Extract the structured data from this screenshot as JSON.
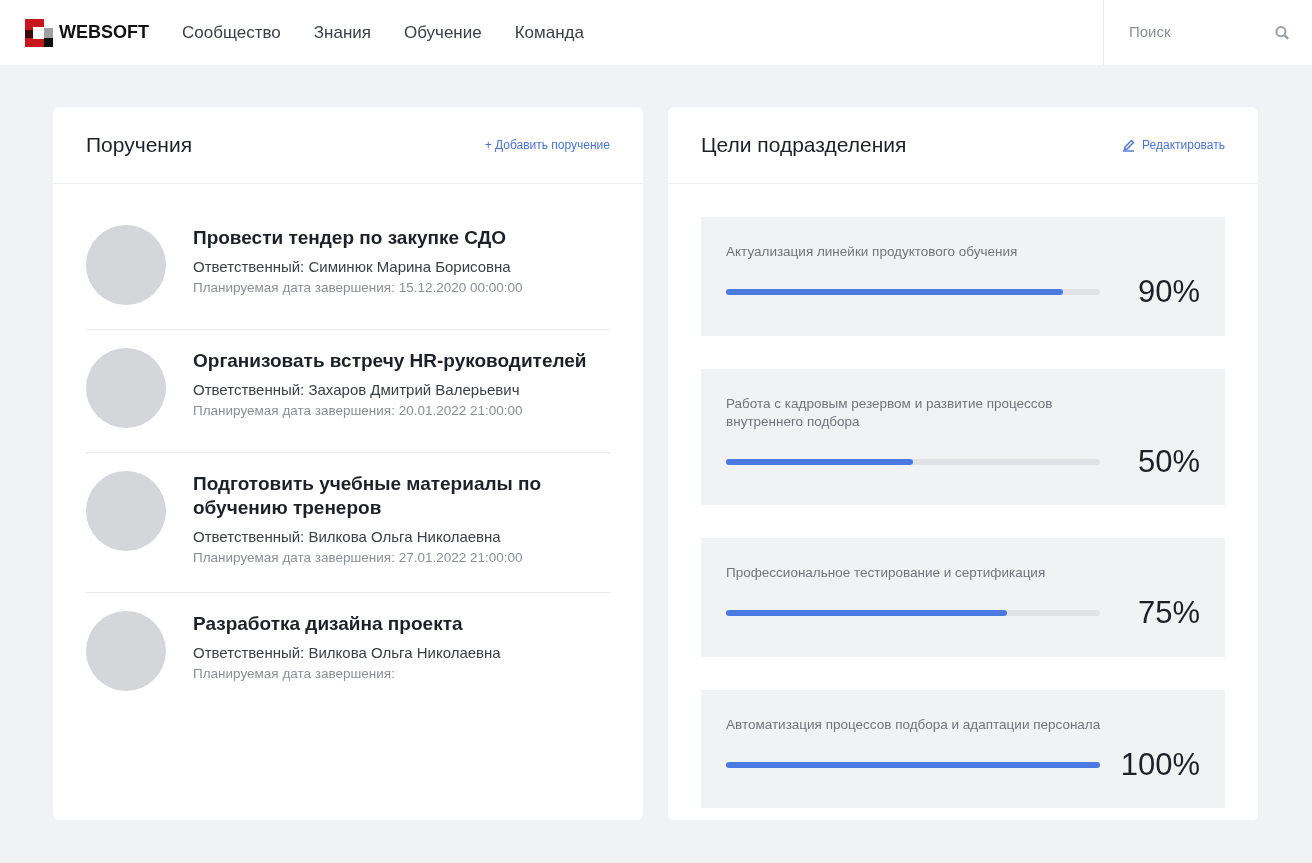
{
  "header": {
    "logo": "WEBSOFT",
    "nav": [
      {
        "label": "Сообщество"
      },
      {
        "label": "Знания"
      },
      {
        "label": "Обучение"
      },
      {
        "label": "Команда"
      }
    ],
    "search": {
      "placeholder": "Поиск"
    }
  },
  "tasks": {
    "title": "Поручения",
    "action": "+ Добавить поручение",
    "items": [
      {
        "title": "Провести тендер по закупке СДО",
        "responsible": "Ответственный: Симинюк Марина Борисовна",
        "due": "Планируемая дата завершения: 15.12.2020 00:00:00"
      },
      {
        "title": "Организовать встречу HR-руководителей",
        "responsible": "Ответственный: Захаров Дмитрий Валерьевич",
        "due": "Планируемая дата завершения: 20.01.2022 21:00:00"
      },
      {
        "title": "Подготовить учебные материалы по обучению тренеров",
        "responsible": "Ответственный: Вилкова Ольга Николаевна",
        "due": "Планируемая дата завершения: 27.01.2022 21:00:00"
      },
      {
        "title": "Разработка дизайна проекта",
        "responsible": "Ответственный: Вилкова Ольга Николаевна",
        "due": "Планируемая дата завершения:"
      }
    ]
  },
  "goals": {
    "title": "Цели подразделения",
    "action": "Редактировать",
    "items": [
      {
        "name": "Актуализация линейки продуктового обучения",
        "level": 0.9,
        "reading": "90%"
      },
      {
        "name": "Работа с кадровым резервом и развитие процессов внутреннего подбора",
        "level": 0.5,
        "reading": "50%"
      },
      {
        "name": "Профессиональное тестирование и сертификация",
        "level": 0.75,
        "reading": "75%"
      },
      {
        "name": "Автоматизация процессов подбора и адаптации персонала",
        "level": 1,
        "reading": "100%"
      }
    ]
  }
}
